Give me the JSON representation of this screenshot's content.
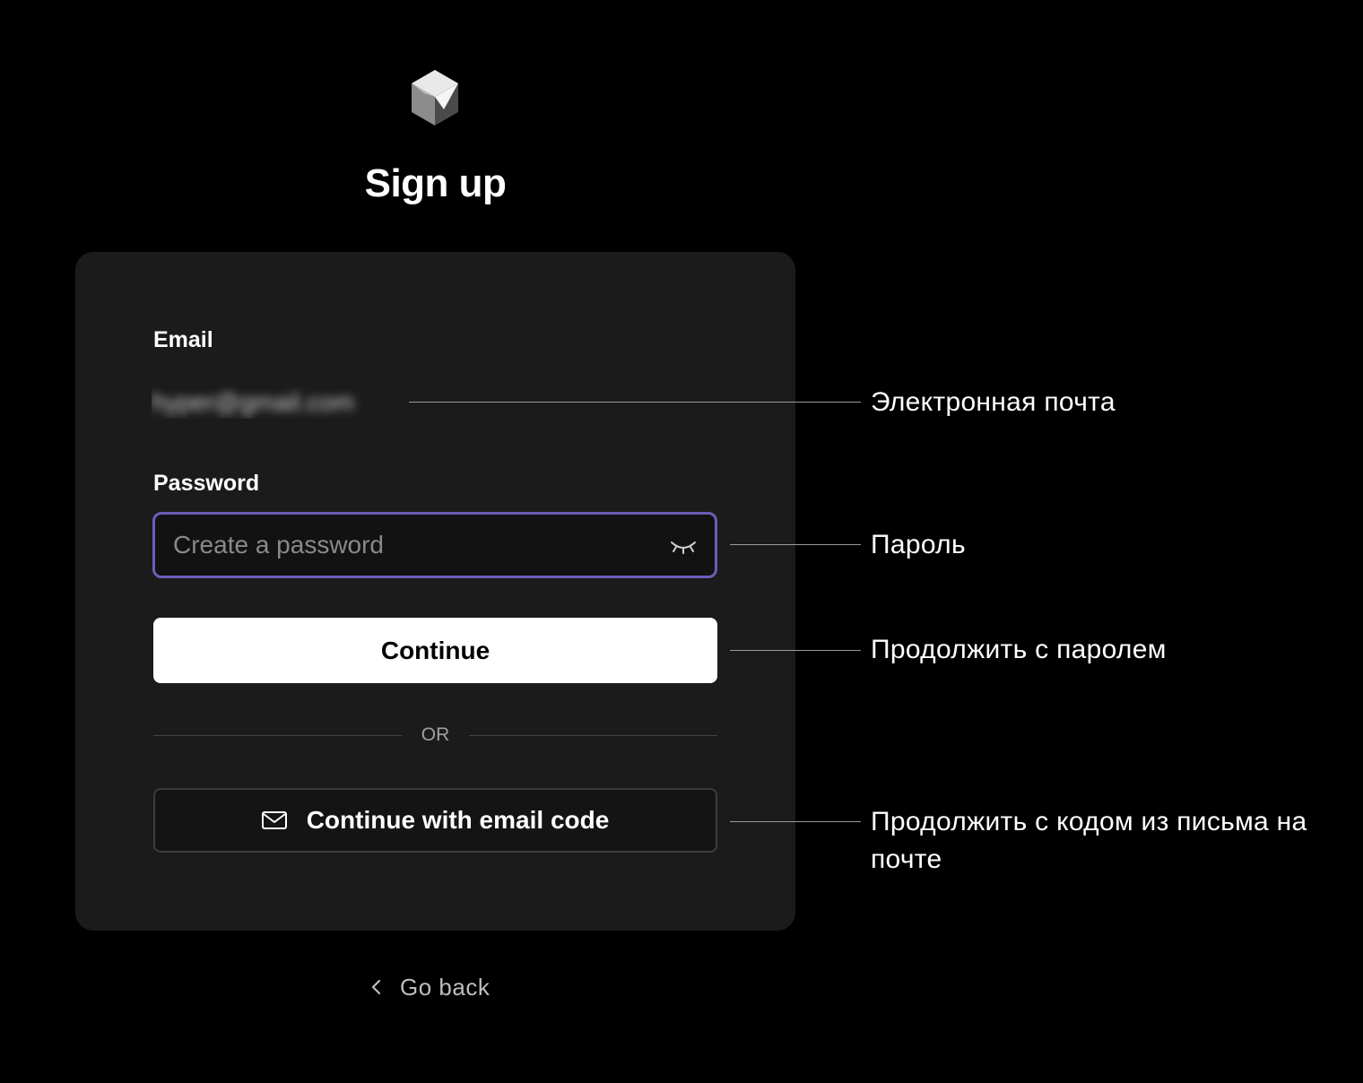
{
  "auth": {
    "title": "Sign up",
    "email_label": "Email",
    "email_value": "hyper@gmail.com",
    "password_label": "Password",
    "password_placeholder": "Create a password",
    "continue_label": "Continue",
    "divider_text": "OR",
    "email_code_label": "Continue with email code",
    "go_back_label": "Go back"
  },
  "annotations": {
    "email": "Электронная почта",
    "password": "Пароль",
    "continue": "Продолжить с паролем",
    "email_code": "Продолжить с кодом из письма на почте"
  },
  "icons": {
    "logo": "cube-logo-icon",
    "password_toggle": "eye-closed-icon",
    "email_code": "mail-icon",
    "go_back": "chevron-left-icon"
  },
  "colors": {
    "background": "#000000",
    "card": "#1b1b1b",
    "focus_border": "#6e5cb8",
    "primary_button": "#ffffff",
    "primary_button_text": "#000000"
  }
}
